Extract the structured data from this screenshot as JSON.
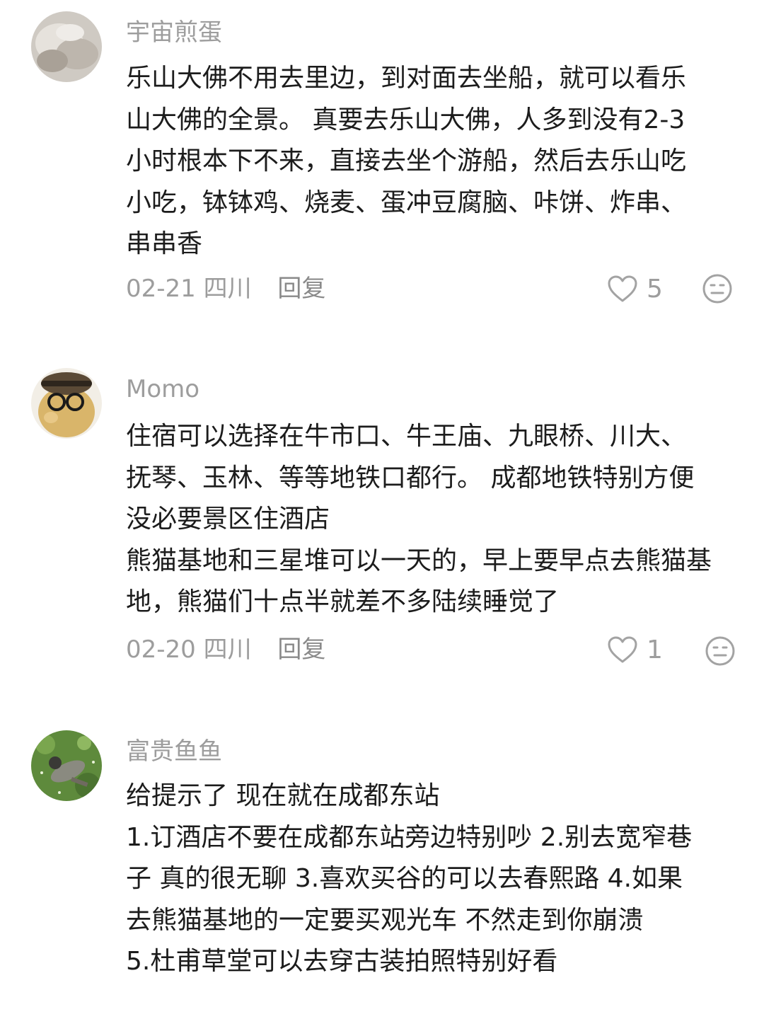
{
  "comments": [
    {
      "username": "宇宙煎蛋",
      "lines": [
        "乐山大佛不用去里边，到对面去坐船，就可以看乐",
        "山大佛的全景。 真要去乐山大佛，人多到没有2-3",
        "小时根本下不来，直接去坐个游船，然后去乐山吃",
        "小吃，钵钵鸡、烧麦、蛋冲豆腐脑、咔饼、炸串、",
        "串串香"
      ],
      "date": "02-21",
      "location": "四川",
      "reply_label": "回复",
      "likes": "5",
      "icons": {
        "like": "heart-icon",
        "react": "sticker-icon"
      }
    },
    {
      "username": "Momo",
      "lines": [
        "住宿可以选择在牛市口、牛王庙、九眼桥、川大、",
        "抚琴、玉林、等等地铁口都行。 成都地铁特别方便",
        "没必要景区住酒店",
        "熊猫基地和三星堆可以一天的，早上要早点去熊猫基",
        "地，熊猫们十点半就差不多陆续睡觉了"
      ],
      "date": "02-20",
      "location": "四川",
      "reply_label": "回复",
      "likes": "1",
      "icons": {
        "like": "heart-icon",
        "react": "sticker-icon"
      }
    },
    {
      "username": "富贵鱼鱼",
      "lines": [
        "给提示了  现在就在成都东站",
        "1.订酒店不要在成都东站旁边特别吵    2.别去宽窄巷",
        "子  真的很无聊   3.喜欢买谷的可以去春熙路    4.如果",
        "去熊猫基地的一定要买观光车   不然走到你崩溃",
        "5.杜甫草堂可以去穿古装拍照特别好看"
      ]
    }
  ]
}
